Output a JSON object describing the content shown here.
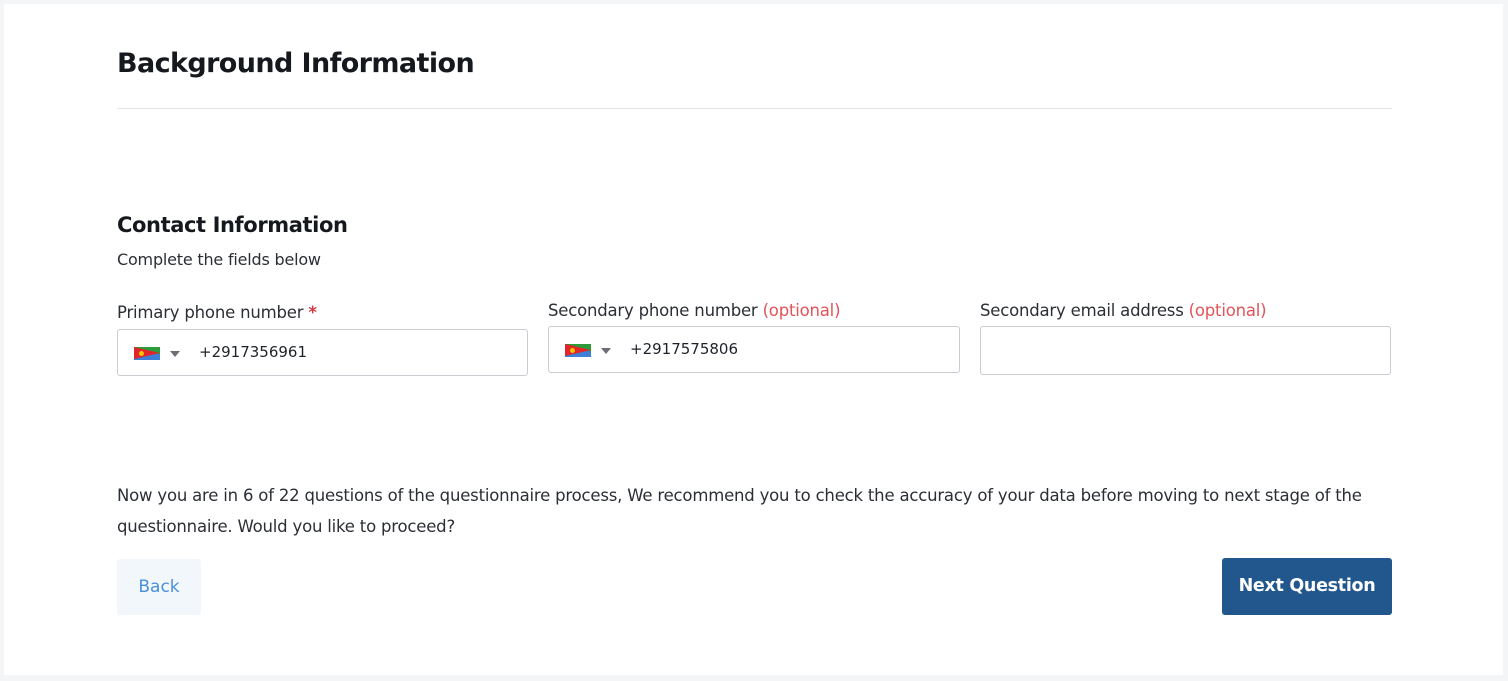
{
  "header": {
    "title": "Background Information"
  },
  "section": {
    "title": "Contact Information",
    "subtitle": "Complete the fields below"
  },
  "fields": {
    "primary_phone": {
      "label": "Primary phone number",
      "required_marker": "*",
      "country_flag": "eritrea-flag-icon",
      "value": "+2917356961"
    },
    "secondary_phone": {
      "label": "Secondary phone number",
      "optional_marker": "(optional)",
      "country_flag": "eritrea-flag-icon",
      "value": "+2917575806"
    },
    "secondary_email": {
      "label": "Secondary email address",
      "optional_marker": "(optional)",
      "value": ""
    }
  },
  "notice": {
    "text": "Now you are in 6 of 22 questions of the questionnaire process, We recommend you to check the accuracy of your data before moving to next stage of the questionnaire. Would you like to proceed?"
  },
  "actions": {
    "back_label": "Back",
    "next_label": "Next Question"
  },
  "colors": {
    "primary_button": "#22578d",
    "required": "#d9363e",
    "optional": "#e0545a",
    "back_text": "#4a90d9"
  }
}
